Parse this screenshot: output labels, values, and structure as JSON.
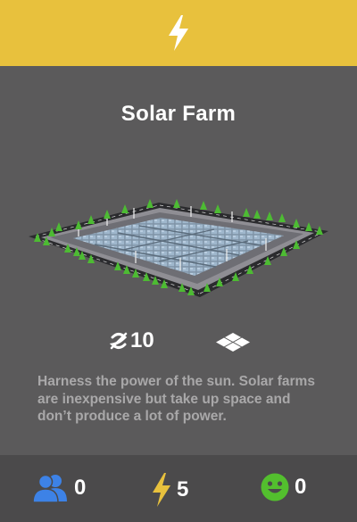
{
  "header": {
    "icon": "lightning-bolt-icon",
    "color": "#e8c13d"
  },
  "building": {
    "name": "Solar Farm",
    "cost": "10",
    "cost_icon": "currency-icon",
    "size_icon": "footprint-grid-icon",
    "description": "Harness the power of the sun. Solar farms are inexpensive but take up space and don’t produce a lot of power."
  },
  "effects": {
    "population": {
      "icon": "people-icon",
      "value": "0",
      "color": "#3d82e6"
    },
    "power": {
      "icon": "lightning-bolt-icon",
      "value": "5",
      "color": "#e8c13d"
    },
    "happiness": {
      "icon": "smiley-face-icon",
      "value": "0",
      "color": "#53bf2e"
    }
  }
}
